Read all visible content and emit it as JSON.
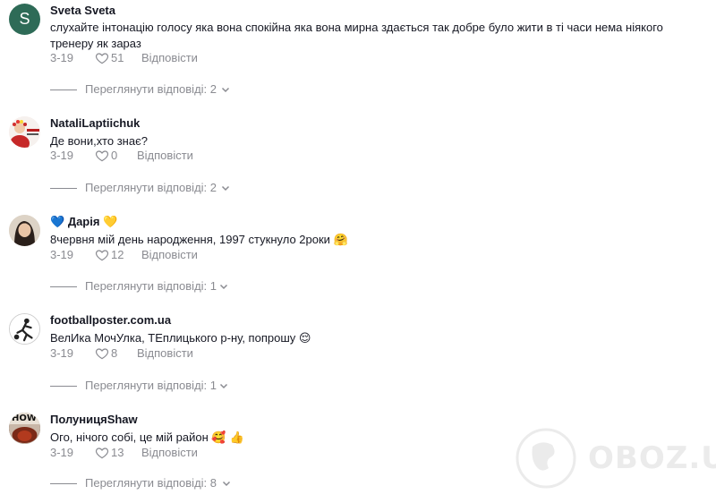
{
  "comments": [
    {
      "username": "Sveta Sveta",
      "avatar_letter": "S",
      "avatar_color": "#2e6b57",
      "text": "слухайте інтонацію голосу яка вона спокійна яка вона мирна здається так добре було жити в ті часи нема ніякого тренеру як зараз",
      "date": "3-19",
      "likes": "51",
      "reply_label": "Відповісти",
      "view_replies": "Переглянути відповіді: 2"
    },
    {
      "username": "NataliLaptiichuk",
      "text": "Де вони,хто знає?",
      "date": "3-19",
      "likes": "0",
      "reply_label": "Відповісти",
      "view_replies": "Переглянути відповіді: 2"
    },
    {
      "username_prefix_emoji": "💙",
      "username": "Дарія",
      "username_suffix_emoji": "💛",
      "text": "8червня мій день народження, 1997 стукнуло 2роки",
      "text_emoji": "🤗",
      "date": "3-19",
      "likes": "12",
      "reply_label": "Відповісти",
      "view_replies": "Переглянути відповіді: 1"
    },
    {
      "username": "footballposter.com.ua",
      "text": "ВелИка МочУлка, ТЕплицького р-ну, попрошу",
      "text_emoji": "😌",
      "date": "3-19",
      "likes": "8",
      "reply_label": "Відповісти",
      "view_replies": "Переглянути відповіді: 1"
    },
    {
      "username": "ПолуницяShaw",
      "avatar_text": "HOW",
      "text": "Ого, нічого собі, це мій район",
      "text_emoji": "🥰 👍",
      "date": "3-19",
      "likes": "13",
      "reply_label": "Відповісти",
      "view_replies": "Переглянути відповіді: 8"
    }
  ],
  "watermark": "OBOZ.UA",
  "colors": {
    "meta_gray": "#8a8b91",
    "text": "#161823",
    "avatar_green": "#2e6b57"
  },
  "icons": [
    "heart-icon",
    "chevron-down-icon"
  ]
}
